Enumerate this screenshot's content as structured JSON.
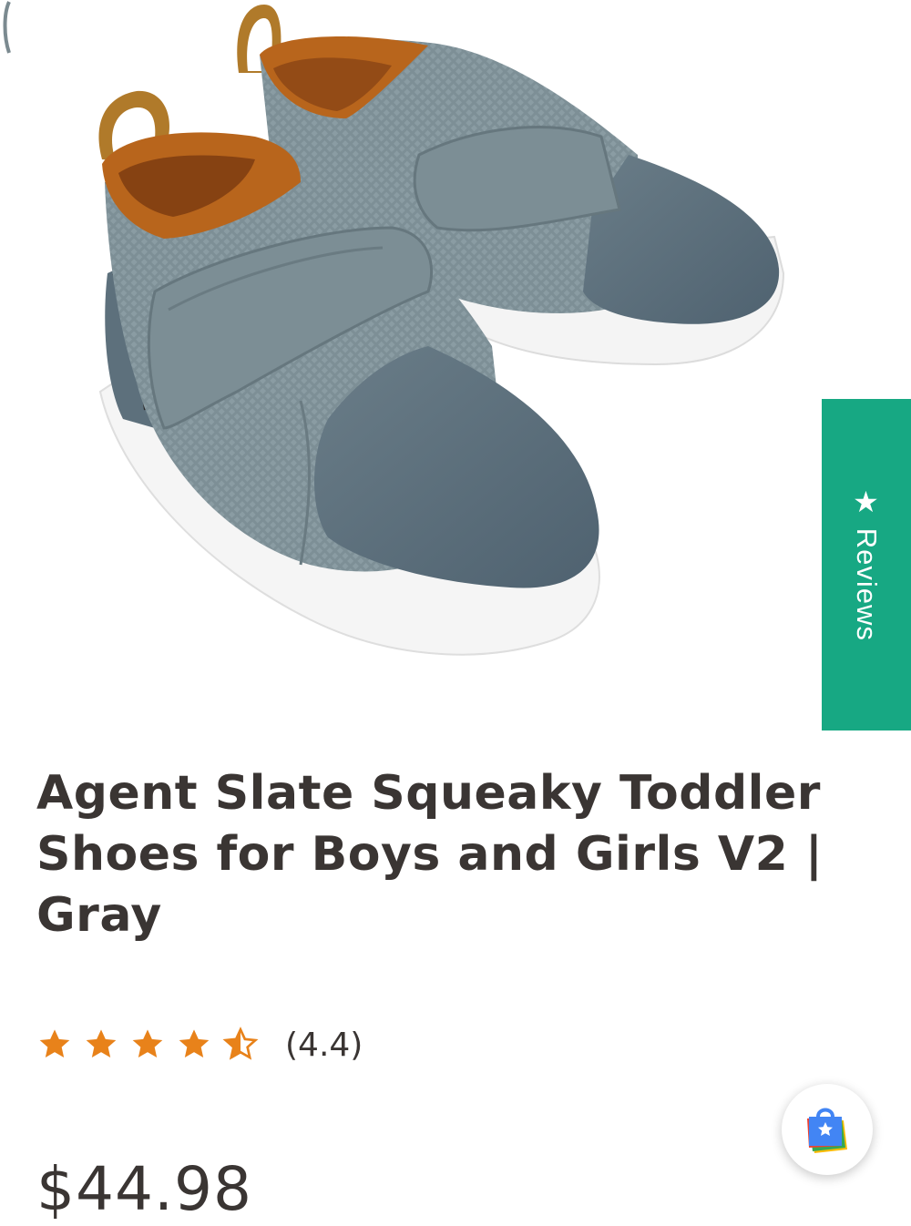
{
  "product": {
    "title": "Agent Slate Squeaky Toddler Shoes for Boys and Girls V2 | Gray",
    "price": "$44.98",
    "image_alt": "Agent Slate Squeaky Toddler Shoes, gray mesh with velcro strap"
  },
  "rating": {
    "value": 4.4,
    "max": 5,
    "display": "(4.4)",
    "star_color": "#e8821a"
  },
  "reviews_tab": {
    "label": "Reviews",
    "icon": "star-icon",
    "background": "#17a883"
  },
  "floating_badge": {
    "icon": "shopping-bag-star-icon"
  }
}
